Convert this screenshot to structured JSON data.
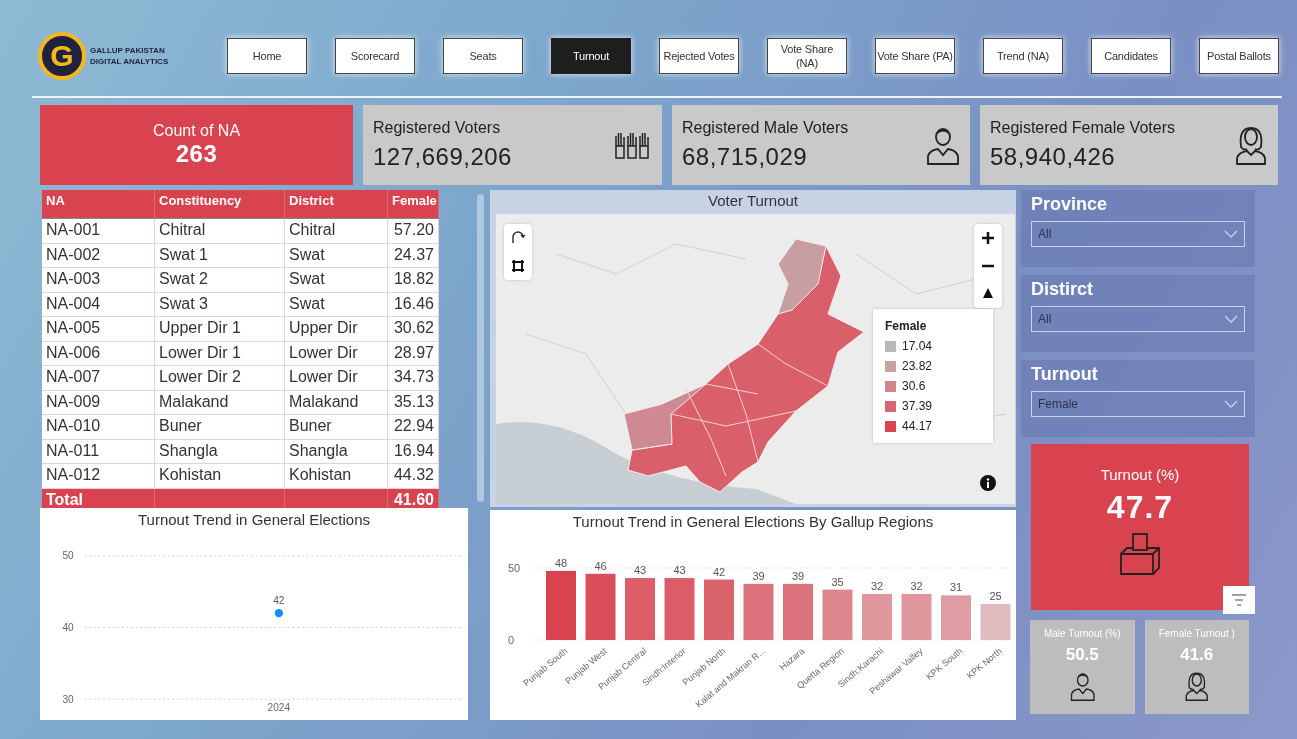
{
  "logo": {
    "letter": "G",
    "line1": "GALLUP PAKISTAN",
    "line2": "DIGITAL ANALYTICS"
  },
  "nav": [
    {
      "label": "Home",
      "selected": false
    },
    {
      "label": "Scorecard",
      "selected": false
    },
    {
      "label": "Seats",
      "selected": false
    },
    {
      "label": "Turnout",
      "selected": true
    },
    {
      "label": "Rejected Votes",
      "selected": false
    },
    {
      "label": "Vote Share (NA)",
      "selected": false
    },
    {
      "label": "Vote Share (PA)",
      "selected": false
    },
    {
      "label": "Trend (NA)",
      "selected": false
    },
    {
      "label": "Candidates",
      "selected": false
    },
    {
      "label": "Postal Ballots",
      "selected": false
    }
  ],
  "kpis": [
    {
      "kind": "count",
      "label": "Count of NA",
      "value": "263"
    },
    {
      "kind": "voters",
      "label": "Registered Voters",
      "value": "127,669,206"
    },
    {
      "kind": "male",
      "label": "Registered Male Voters",
      "value": "68,715,029"
    },
    {
      "kind": "female",
      "label": "Registered Female Voters",
      "value": "58,940,426"
    }
  ],
  "table": {
    "columns": [
      "NA",
      "Constituency",
      "District",
      "Female"
    ],
    "rows": [
      [
        "NA-001",
        "Chitral",
        "Chitral",
        "57.20"
      ],
      [
        "NA-002",
        "Swat 1",
        "Swat",
        "24.37"
      ],
      [
        "NA-003",
        "Swat 2",
        "Swat",
        "18.82"
      ],
      [
        "NA-004",
        "Swat 3",
        "Swat",
        "16.46"
      ],
      [
        "NA-005",
        "Upper Dir 1",
        "Upper Dir",
        "30.62"
      ],
      [
        "NA-006",
        "Lower Dir 1",
        "Lower Dir",
        "28.97"
      ],
      [
        "NA-007",
        "Lower Dir 2",
        "Lower Dir",
        "34.73"
      ],
      [
        "NA-009",
        "Malakand",
        "Malakand",
        "35.13"
      ],
      [
        "NA-010",
        "Buner",
        "Buner",
        "22.94"
      ],
      [
        "NA-011",
        "Shangla",
        "Shangla",
        "16.94"
      ],
      [
        "NA-012",
        "Kohistan",
        "Kohistan",
        "44.32"
      ]
    ],
    "total": {
      "label": "Total",
      "value": "41.60"
    }
  },
  "map": {
    "title": "Voter Turnout",
    "legend_title": "Female",
    "legend": [
      {
        "label": "17.04",
        "color": "#b9b9b9"
      },
      {
        "label": "23.82",
        "color": "#c9a0a4"
      },
      {
        "label": "30.6",
        "color": "#d4848b"
      },
      {
        "label": "37.39",
        "color": "#d86670"
      },
      {
        "label": "44.17",
        "color": "#d94451"
      }
    ]
  },
  "line_chart": {
    "chart_data": {
      "type": "line",
      "title": "Turnout Trend in General Elections",
      "x": [
        "2024"
      ],
      "values": [
        42
      ],
      "ylim": [
        30,
        50
      ],
      "yticks": [
        30,
        40,
        50
      ],
      "marker": true,
      "data_labels": true
    }
  },
  "bar_chart": {
    "chart_data": {
      "type": "bar",
      "title": "Turnout Trend in General Elections By Gallup Regions",
      "categories": [
        "Punjab South",
        "Punjab West",
        "Punjab Central",
        "Sindh:Interior",
        "Punjab North",
        "Kalat and Makran R...",
        "Hazara",
        "Quetta Region",
        "Sindh:Karachi",
        "Peshawar Valley",
        "KPK South",
        "KPK North"
      ],
      "values": [
        48,
        46,
        43,
        43,
        42,
        39,
        39,
        35,
        32,
        32,
        31,
        25
      ],
      "ylim": [
        0,
        50
      ],
      "yticks": [
        0,
        50
      ],
      "data_labels": true
    }
  },
  "filters": [
    {
      "title": "Province",
      "value": "All"
    },
    {
      "title": "Distirct",
      "value": "All"
    },
    {
      "title": "Turnout",
      "value": "Female"
    }
  ],
  "turnout": {
    "label": "Turnout (%)",
    "value": "47.7"
  },
  "small_cards": [
    {
      "kind": "male",
      "label": "Male Turnout (%)",
      "value": "50.5"
    },
    {
      "kind": "female",
      "label": "Female Turnout )",
      "value": "41.6"
    }
  ]
}
